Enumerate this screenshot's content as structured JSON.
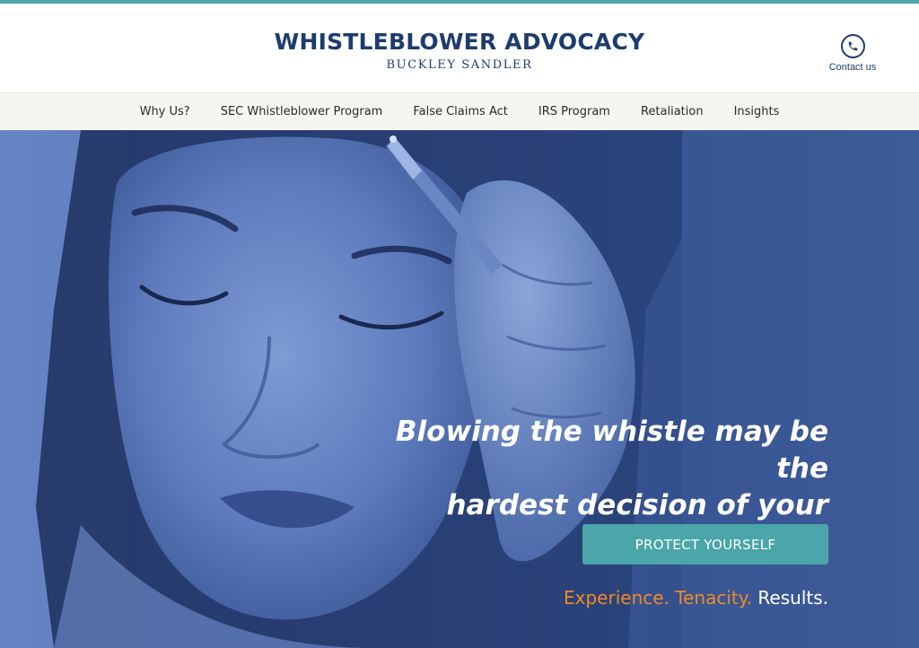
{
  "brand": {
    "title": "WHISTLEBLOWER ADVOCACY",
    "subtitle": "BUCKLEY SANDLER"
  },
  "contact": {
    "label": "Contact us",
    "icon": "phone-icon"
  },
  "nav": {
    "items": [
      {
        "label": "Why Us?"
      },
      {
        "label": "SEC Whistleblower Program"
      },
      {
        "label": "False Claims Act"
      },
      {
        "label": "IRS Program"
      },
      {
        "label": "Retaliation"
      },
      {
        "label": "Insights"
      }
    ]
  },
  "hero": {
    "headline_line1": "Blowing the whistle may be the",
    "headline_line2": "hardest decision of your career.",
    "cta_label": "PROTECT YOURSELF",
    "tagline_orange": "Experience. Tenacity.",
    "tagline_white": "Results."
  },
  "colors": {
    "brand_navy": "#1d3c6e",
    "accent_teal": "#4aa6a8",
    "tagline_orange": "#f08a24",
    "hero_blue": "#3a5898"
  }
}
